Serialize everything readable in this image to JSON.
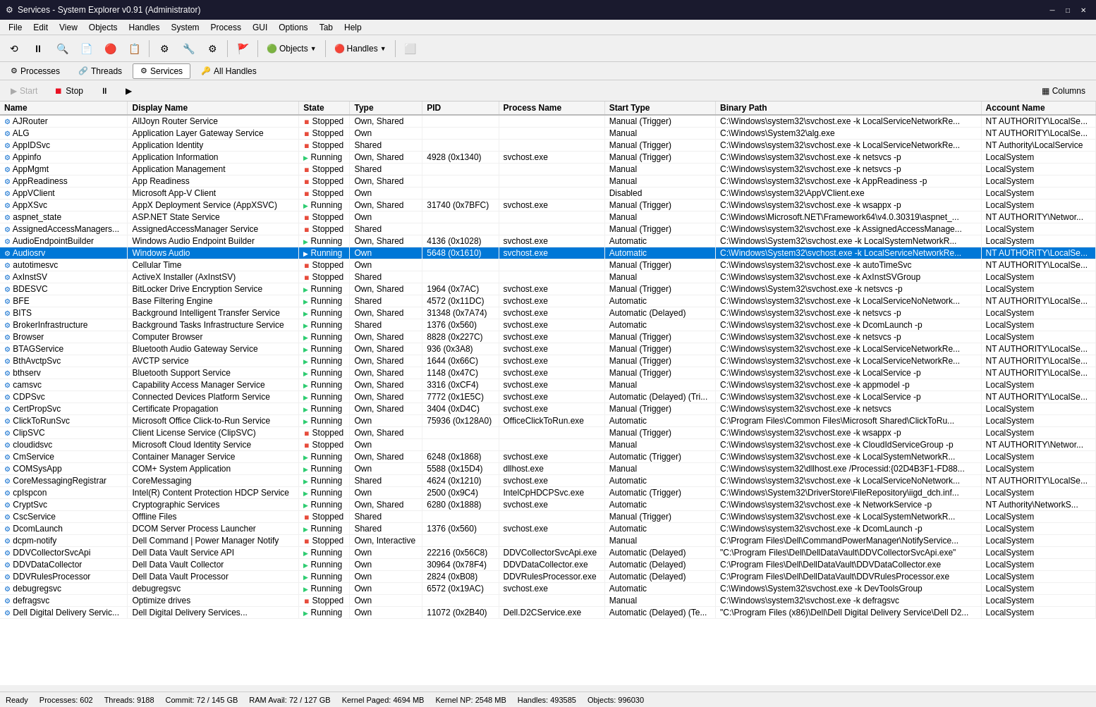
{
  "titlebar": {
    "icon": "⚙",
    "title": "Services - System Explorer v0.91 (Administrator)",
    "minimize": "─",
    "maximize": "□",
    "close": "✕"
  },
  "menu": {
    "items": [
      "File",
      "Edit",
      "View",
      "Objects",
      "Handles",
      "System",
      "Process",
      "GUI",
      "Options",
      "Tab",
      "Help"
    ]
  },
  "toolbar": {
    "buttons": [
      "⟲",
      "⏸",
      "🔍",
      "📄",
      "🔴",
      "📋",
      "⚙",
      "🔧",
      "⚙"
    ],
    "objects_label": "Objects",
    "handles_label": "Handles"
  },
  "tabs": [
    {
      "label": "Processes",
      "icon": "⚙",
      "active": false
    },
    {
      "label": "Threads",
      "icon": "🔗",
      "active": false
    },
    {
      "label": "Services",
      "icon": "⚙",
      "active": true
    },
    {
      "label": "All Handles",
      "icon": "🔑",
      "active": false
    }
  ],
  "actions": {
    "start": "Start",
    "stop": "Stop",
    "pause": "⏸",
    "resume": "▶",
    "columns": "Columns"
  },
  "columns": [
    "Name",
    "Display Name",
    "State",
    "Type",
    "PID",
    "Process Name",
    "Start Type",
    "Binary Path",
    "Account Name"
  ],
  "services": [
    {
      "name": "AJRouter",
      "display": "AllJoyn Router Service",
      "state": "Stopped",
      "type": "Own, Shared",
      "pid": "",
      "process": "",
      "starttype": "Manual (Trigger)",
      "binary": "C:\\Windows\\system32\\svchost.exe -k LocalServiceNetworkRe...",
      "account": "NT AUTHORITY\\LocalSe..."
    },
    {
      "name": "ALG",
      "display": "Application Layer Gateway Service",
      "state": "Stopped",
      "type": "Own",
      "pid": "",
      "process": "",
      "starttype": "Manual",
      "binary": "C:\\Windows\\System32\\alg.exe",
      "account": "NT AUTHORITY\\LocalSe..."
    },
    {
      "name": "AppIDSvc",
      "display": "Application Identity",
      "state": "Stopped",
      "type": "Shared",
      "pid": "",
      "process": "",
      "starttype": "Manual (Trigger)",
      "binary": "C:\\Windows\\system32\\svchost.exe -k LocalServiceNetworkRe...",
      "account": "NT Authority\\LocalService"
    },
    {
      "name": "Appinfo",
      "display": "Application Information",
      "state": "Running",
      "type": "Own, Shared",
      "pid": "4928 (0x1340)",
      "process": "svchost.exe",
      "starttype": "Manual (Trigger)",
      "binary": "C:\\Windows\\system32\\svchost.exe -k netsvcs -p",
      "account": "LocalSystem"
    },
    {
      "name": "AppMgmt",
      "display": "Application Management",
      "state": "Stopped",
      "type": "Shared",
      "pid": "",
      "process": "",
      "starttype": "Manual",
      "binary": "C:\\Windows\\system32\\svchost.exe -k netsvcs -p",
      "account": "LocalSystem"
    },
    {
      "name": "AppReadiness",
      "display": "App Readiness",
      "state": "Stopped",
      "type": "Own, Shared",
      "pid": "",
      "process": "",
      "starttype": "Manual",
      "binary": "C:\\Windows\\system32\\svchost.exe -k AppReadiness -p",
      "account": "LocalSystem"
    },
    {
      "name": "AppVClient",
      "display": "Microsoft App-V Client",
      "state": "Stopped",
      "type": "Own",
      "pid": "",
      "process": "",
      "starttype": "Disabled",
      "binary": "C:\\Windows\\system32\\AppVClient.exe",
      "account": "LocalSystem"
    },
    {
      "name": "AppXSvc",
      "display": "AppX Deployment Service (AppXSVC)",
      "state": "Running",
      "type": "Own, Shared",
      "pid": "31740 (0x7BFC)",
      "process": "svchost.exe",
      "starttype": "Manual (Trigger)",
      "binary": "C:\\Windows\\system32\\svchost.exe -k wsappx -p",
      "account": "LocalSystem"
    },
    {
      "name": "aspnet_state",
      "display": "ASP.NET State Service",
      "state": "Stopped",
      "type": "Own",
      "pid": "",
      "process": "",
      "starttype": "Manual",
      "binary": "C:\\Windows\\Microsoft.NET\\Framework64\\v4.0.30319\\aspnet_...",
      "account": "NT AUTHORITY\\Networ..."
    },
    {
      "name": "AssignedAccessManagers...",
      "display": "AssignedAccessManager Service",
      "state": "Stopped",
      "type": "Shared",
      "pid": "",
      "process": "",
      "starttype": "Manual (Trigger)",
      "binary": "C:\\Windows\\system32\\svchost.exe -k AssignedAccessManage...",
      "account": "LocalSystem"
    },
    {
      "name": "AudioEndpointBuilder",
      "display": "Windows Audio Endpoint Builder",
      "state": "Running",
      "type": "Own, Shared",
      "pid": "4136 (0x1028)",
      "process": "svchost.exe",
      "starttype": "Automatic",
      "binary": "C:\\Windows\\System32\\svchost.exe -k LocalSystemNetworkR...",
      "account": "LocalSystem"
    },
    {
      "name": "Audiosrv",
      "display": "Windows Audio",
      "state": "Running",
      "type": "Own",
      "pid": "5648 (0x1610)",
      "process": "svchost.exe",
      "starttype": "Automatic",
      "binary": "C:\\Windows\\System32\\svchost.exe -k LocalServiceNetworkRe...",
      "account": "NT AUTHORITY\\LocalSe...",
      "selected": true
    },
    {
      "name": "autotimesvc",
      "display": "Cellular Time",
      "state": "Stopped",
      "type": "Own",
      "pid": "",
      "process": "",
      "starttype": "Manual (Trigger)",
      "binary": "C:\\Windows\\system32\\svchost.exe -k autoTimeSvc",
      "account": "NT AUTHORITY\\LocalSe..."
    },
    {
      "name": "AxInstSV",
      "display": "ActiveX Installer (AxInstSV)",
      "state": "Stopped",
      "type": "Shared",
      "pid": "",
      "process": "",
      "starttype": "Manual",
      "binary": "C:\\Windows\\system32\\svchost.exe -k AxInstSVGroup",
      "account": "LocalSystem"
    },
    {
      "name": "BDESVC",
      "display": "BitLocker Drive Encryption Service",
      "state": "Running",
      "type": "Own, Shared",
      "pid": "1964 (0x7AC)",
      "process": "svchost.exe",
      "starttype": "Manual (Trigger)",
      "binary": "C:\\Windows\\System32\\svchost.exe -k netsvcs -p",
      "account": "LocalSystem"
    },
    {
      "name": "BFE",
      "display": "Base Filtering Engine",
      "state": "Running",
      "type": "Shared",
      "pid": "4572 (0x11DC)",
      "process": "svchost.exe",
      "starttype": "Automatic",
      "binary": "C:\\Windows\\system32\\svchost.exe -k LocalServiceNoNetwork...",
      "account": "NT AUTHORITY\\LocalSe..."
    },
    {
      "name": "BITS",
      "display": "Background Intelligent Transfer Service",
      "state": "Running",
      "type": "Own, Shared",
      "pid": "31348 (0x7A74)",
      "process": "svchost.exe",
      "starttype": "Automatic (Delayed)",
      "binary": "C:\\Windows\\system32\\svchost.exe -k netsvcs -p",
      "account": "LocalSystem"
    },
    {
      "name": "BrokerInfrastructure",
      "display": "Background Tasks Infrastructure Service",
      "state": "Running",
      "type": "Shared",
      "pid": "1376 (0x560)",
      "process": "svchost.exe",
      "starttype": "Automatic",
      "binary": "C:\\Windows\\system32\\svchost.exe -k DcomLaunch -p",
      "account": "LocalSystem"
    },
    {
      "name": "Browser",
      "display": "Computer Browser",
      "state": "Running",
      "type": "Own, Shared",
      "pid": "8828 (0x227C)",
      "process": "svchost.exe",
      "starttype": "Manual (Trigger)",
      "binary": "C:\\Windows\\system32\\svchost.exe -k netsvcs -p",
      "account": "LocalSystem"
    },
    {
      "name": "BTAGService",
      "display": "Bluetooth Audio Gateway Service",
      "state": "Running",
      "type": "Own, Shared",
      "pid": "936 (0x3A8)",
      "process": "svchost.exe",
      "starttype": "Manual (Trigger)",
      "binary": "C:\\Windows\\system32\\svchost.exe -k LocalServiceNetworkRe...",
      "account": "NT AUTHORITY\\LocalSe..."
    },
    {
      "name": "BthAvctpSvc",
      "display": "AVCTP service",
      "state": "Running",
      "type": "Own, Shared",
      "pid": "1644 (0x66C)",
      "process": "svchost.exe",
      "starttype": "Manual (Trigger)",
      "binary": "C:\\Windows\\system32\\svchost.exe -k LocalServiceNetworkRe...",
      "account": "NT AUTHORITY\\LocalSe..."
    },
    {
      "name": "bthserv",
      "display": "Bluetooth Support Service",
      "state": "Running",
      "type": "Own, Shared",
      "pid": "1148 (0x47C)",
      "process": "svchost.exe",
      "starttype": "Manual (Trigger)",
      "binary": "C:\\Windows\\system32\\svchost.exe -k LocalService -p",
      "account": "NT AUTHORITY\\LocalSe..."
    },
    {
      "name": "camsvc",
      "display": "Capability Access Manager Service",
      "state": "Running",
      "type": "Own, Shared",
      "pid": "3316 (0xCF4)",
      "process": "svchost.exe",
      "starttype": "Manual",
      "binary": "C:\\Windows\\system32\\svchost.exe -k appmodel -p",
      "account": "LocalSystem"
    },
    {
      "name": "CDPSvc",
      "display": "Connected Devices Platform Service",
      "state": "Running",
      "type": "Own, Shared",
      "pid": "7772 (0x1E5C)",
      "process": "svchost.exe",
      "starttype": "Automatic (Delayed) (Tri...",
      "binary": "C:\\Windows\\system32\\svchost.exe -k LocalService -p",
      "account": "NT AUTHORITY\\LocalSe..."
    },
    {
      "name": "CertPropSvc",
      "display": "Certificate Propagation",
      "state": "Running",
      "type": "Own, Shared",
      "pid": "3404 (0xD4C)",
      "process": "svchost.exe",
      "starttype": "Manual (Trigger)",
      "binary": "C:\\Windows\\system32\\svchost.exe -k netsvcs",
      "account": "LocalSystem"
    },
    {
      "name": "ClickToRunSvc",
      "display": "Microsoft Office Click-to-Run Service",
      "state": "Running",
      "type": "Own",
      "pid": "75936 (0x128A0)",
      "process": "OfficeClickToRun.exe",
      "starttype": "Automatic",
      "binary": "C:\\Program Files\\Common Files\\Microsoft Shared\\ClickToRu...",
      "account": "LocalSystem"
    },
    {
      "name": "ClipSVC",
      "display": "Client License Service (ClipSVC)",
      "state": "Stopped",
      "type": "Own, Shared",
      "pid": "",
      "process": "",
      "starttype": "Manual (Trigger)",
      "binary": "C:\\Windows\\system32\\svchost.exe -k wsappx -p",
      "account": "LocalSystem"
    },
    {
      "name": "cloudidsvc",
      "display": "Microsoft Cloud Identity Service",
      "state": "Stopped",
      "type": "Own",
      "pid": "",
      "process": "",
      "starttype": "Manual",
      "binary": "C:\\Windows\\system32\\svchost.exe -k CloudIdServiceGroup -p",
      "account": "NT AUTHORITY\\Networ..."
    },
    {
      "name": "CmService",
      "display": "Container Manager Service",
      "state": "Running",
      "type": "Own, Shared",
      "pid": "6248 (0x1868)",
      "process": "svchost.exe",
      "starttype": "Automatic (Trigger)",
      "binary": "C:\\Windows\\system32\\svchost.exe -k LocalSystemNetworkR...",
      "account": "LocalSystem"
    },
    {
      "name": "COMSysApp",
      "display": "COM+ System Application",
      "state": "Running",
      "type": "Own",
      "pid": "5588 (0x15D4)",
      "process": "dllhost.exe",
      "starttype": "Manual",
      "binary": "C:\\Windows\\system32\\dllhost.exe /Processid:{02D4B3F1-FD88...",
      "account": "LocalSystem"
    },
    {
      "name": "CoreMessagingRegistrar",
      "display": "CoreMessaging",
      "state": "Running",
      "type": "Shared",
      "pid": "4624 (0x1210)",
      "process": "svchost.exe",
      "starttype": "Automatic",
      "binary": "C:\\Windows\\system32\\svchost.exe -k LocalServiceNoNetwork...",
      "account": "NT AUTHORITY\\LocalSe..."
    },
    {
      "name": "cpIspcon",
      "display": "Intel(R) Content Protection HDCP Service",
      "state": "Running",
      "type": "Own",
      "pid": "2500 (0x9C4)",
      "process": "IntelCpHDCPSvc.exe",
      "starttype": "Automatic (Trigger)",
      "binary": "C:\\Windows\\System32\\DriverStore\\FileRepository\\iigd_dch.inf...",
      "account": "LocalSystem"
    },
    {
      "name": "CryptSvc",
      "display": "Cryptographic Services",
      "state": "Running",
      "type": "Own, Shared",
      "pid": "6280 (0x1888)",
      "process": "svchost.exe",
      "starttype": "Automatic",
      "binary": "C:\\Windows\\system32\\svchost.exe -k NetworkService -p",
      "account": "NT Authority\\NetworkS..."
    },
    {
      "name": "CscService",
      "display": "Offline Files",
      "state": "Stopped",
      "type": "Shared",
      "pid": "",
      "process": "",
      "starttype": "Manual (Trigger)",
      "binary": "C:\\Windows\\system32\\svchost.exe -k LocalSystemNetworkR...",
      "account": "LocalSystem"
    },
    {
      "name": "DcomLaunch",
      "display": "DCOM Server Process Launcher",
      "state": "Running",
      "type": "Shared",
      "pid": "1376 (0x560)",
      "process": "svchost.exe",
      "starttype": "Automatic",
      "binary": "C:\\Windows\\system32\\svchost.exe -k DcomLaunch -p",
      "account": "LocalSystem"
    },
    {
      "name": "dcpm-notify",
      "display": "Dell Command | Power Manager Notify",
      "state": "Stopped",
      "type": "Own, Interactive",
      "pid": "",
      "process": "",
      "starttype": "Manual",
      "binary": "C:\\Program Files\\Dell\\CommandPowerManager\\NotifyService...",
      "account": "LocalSystem"
    },
    {
      "name": "DDVCollectorSvcApi",
      "display": "Dell Data Vault Service API",
      "state": "Running",
      "type": "Own",
      "pid": "22216 (0x56C8)",
      "process": "DDVCollectorSvcApi.exe",
      "starttype": "Automatic (Delayed)",
      "binary": "\"C:\\Program Files\\Dell\\DellDataVault\\DDVCollectorSvcApi.exe\"",
      "account": "LocalSystem"
    },
    {
      "name": "DDVDataCollector",
      "display": "Dell Data Vault Collector",
      "state": "Running",
      "type": "Own",
      "pid": "30964 (0x78F4)",
      "process": "DDVDataCollector.exe",
      "starttype": "Automatic (Delayed)",
      "binary": "C:\\Program Files\\Dell\\DellDataVault\\DDVDataCollector.exe",
      "account": "LocalSystem"
    },
    {
      "name": "DDVRulesProcessor",
      "display": "Dell Data Vault Processor",
      "state": "Running",
      "type": "Own",
      "pid": "2824 (0xB08)",
      "process": "DDVRulesProcessor.exe",
      "starttype": "Automatic (Delayed)",
      "binary": "C:\\Program Files\\Dell\\DellDataVault\\DDVRulesProcessor.exe",
      "account": "LocalSystem"
    },
    {
      "name": "debugregsvc",
      "display": "debugregsvc",
      "state": "Running",
      "type": "Own",
      "pid": "6572 (0x19AC)",
      "process": "svchost.exe",
      "starttype": "Automatic",
      "binary": "C:\\Windows\\System32\\svchost.exe -k DevToolsGroup",
      "account": "LocalSystem"
    },
    {
      "name": "defragsvc",
      "display": "Optimize drives",
      "state": "Stopped",
      "type": "Own",
      "pid": "",
      "process": "",
      "starttype": "Manual",
      "binary": "C:\\Windows\\system32\\svchost.exe -k defragsvc",
      "account": "LocalSystem"
    },
    {
      "name": "Dell Digital Delivery Servic...",
      "display": "Dell Digital Delivery Services...",
      "state": "Running",
      "type": "Own",
      "pid": "11072 (0x2B40)",
      "process": "Dell.D2CService.exe",
      "starttype": "Automatic (Delayed) (Te...",
      "binary": "\"C:\\Program Files (x86)\\Dell\\Dell Digital Delivery Service\\Dell D2...",
      "account": "LocalSystem"
    }
  ],
  "statusbar": {
    "ready": "Ready",
    "processes": "Processes: 602",
    "threads": "Threads: 9188",
    "commit": "Commit: 72 / 145 GB",
    "ram": "RAM Avail: 72 / 127 GB",
    "kernel_paged": "Kernel Paged: 4694 MB",
    "kernel_np": "Kernel NP: 2548 MB",
    "handles": "Handles: 493585",
    "objects": "Objects: 996030"
  }
}
